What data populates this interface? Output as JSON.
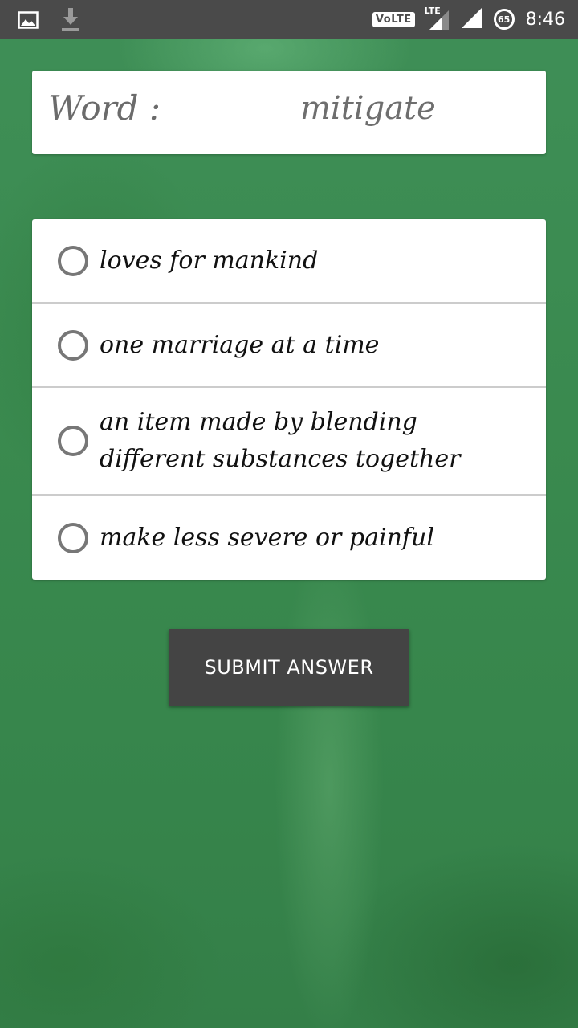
{
  "status_bar": {
    "left_icons": [
      "image-icon",
      "download-icon"
    ],
    "volte": "VoLTE",
    "lte": "LTE",
    "battery": "65",
    "time": "8:46"
  },
  "word_card": {
    "label": "Word :",
    "value": "mitigate"
  },
  "options": [
    {
      "text": "loves for mankind",
      "selected": false
    },
    {
      "text": "one marriage at a time",
      "selected": false
    },
    {
      "text": "an item made by blending different substances together",
      "selected": false
    },
    {
      "text": "make less severe or painful",
      "selected": false
    }
  ],
  "submit": {
    "label": "SUBMIT ANSWER"
  },
  "colors": {
    "status_bar": "#4a4a4a",
    "background": "#3a8a4f",
    "card": "#ffffff",
    "button": "#444444",
    "radio_ring": "#777777"
  }
}
